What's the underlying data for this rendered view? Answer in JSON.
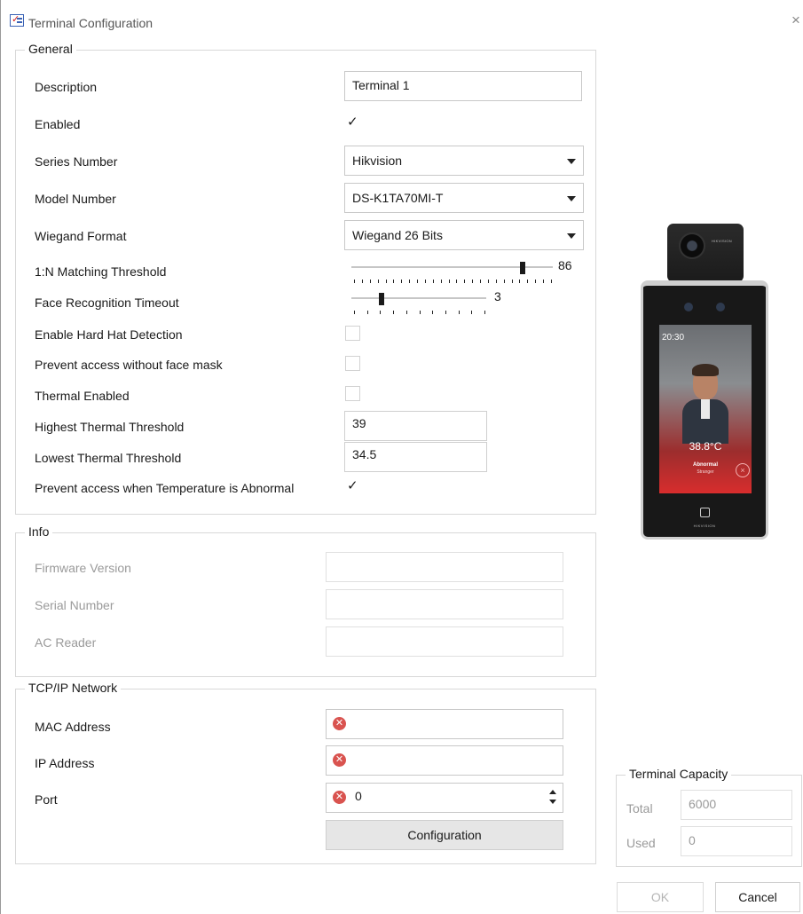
{
  "window": {
    "title": "Terminal Configuration",
    "close_glyph": "×"
  },
  "general": {
    "legend": "General",
    "description": {
      "label": "Description",
      "value": "Terminal 1"
    },
    "enabled": {
      "label": "Enabled",
      "checked": true
    },
    "series_number": {
      "label": "Series Number",
      "value": "Hikvision"
    },
    "model_number": {
      "label": "Model Number",
      "value": "DS-K1TA70MI-T"
    },
    "wiegand_format": {
      "label": "Wiegand Format",
      "value": "Wiegand 26 Bits"
    },
    "matching_threshold": {
      "label": "1:N Matching Threshold",
      "value": "86"
    },
    "face_timeout": {
      "label": "Face Recognition Timeout",
      "value": "3"
    },
    "hard_hat": {
      "label": "Enable Hard Hat Detection",
      "checked": false
    },
    "face_mask": {
      "label": "Prevent access without face mask",
      "checked": false
    },
    "thermal_enabled": {
      "label": "Thermal Enabled",
      "checked": false
    },
    "highest_thermal": {
      "label": "Highest Thermal Threshold",
      "value": "39"
    },
    "lowest_thermal": {
      "label": "Lowest Thermal Threshold",
      "value": "34.5"
    },
    "abnormal_temp": {
      "label": "Prevent access when Temperature is Abnormal",
      "checked": true
    }
  },
  "info": {
    "legend": "Info",
    "firmware": {
      "label": "Firmware Version",
      "value": ""
    },
    "serial": {
      "label": "Serial Number",
      "value": ""
    },
    "ac_reader": {
      "label": "AC Reader",
      "value": ""
    }
  },
  "network": {
    "legend": "TCP/IP Network",
    "mac": {
      "label": "MAC Address",
      "value": ""
    },
    "ip": {
      "label": "IP Address",
      "value": ""
    },
    "port": {
      "label": "Port",
      "value": "0"
    },
    "config_button": "Configuration",
    "error_glyph": "✕"
  },
  "capacity": {
    "legend": "Terminal Capacity",
    "total": {
      "label": "Total",
      "value": "6000"
    },
    "used": {
      "label": "Used",
      "value": "0"
    }
  },
  "device": {
    "time": "20:30",
    "temperature": "38.8°C",
    "status": "Abnormal",
    "substatus": "Stranger",
    "brand": "HIKVISION"
  },
  "footer": {
    "ok_label": "OK",
    "cancel_label": "Cancel"
  },
  "icons": {
    "app_icon": "app-icon",
    "checkmark": "✓",
    "error": "error-icon",
    "dropdown": "chevron-down-icon"
  }
}
